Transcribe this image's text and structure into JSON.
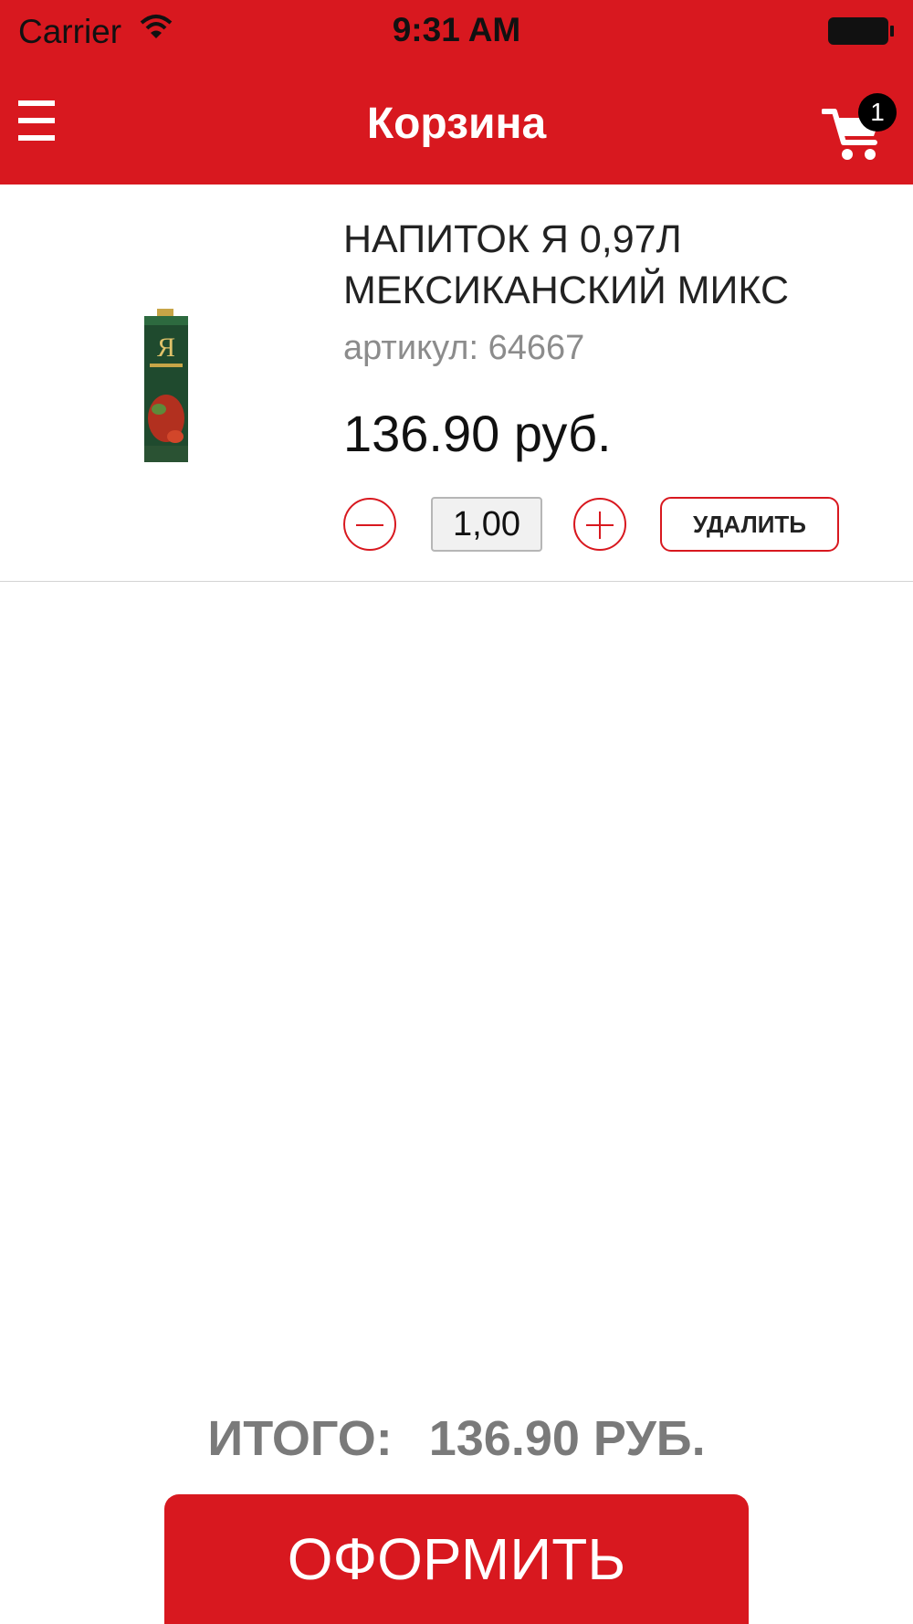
{
  "status_bar": {
    "carrier": "Carrier",
    "time": "9:31 AM"
  },
  "header": {
    "title": "Корзина",
    "cart_count": "1",
    "icons": {
      "menu": "hamburger-menu-icon",
      "cart": "shopping-cart-icon"
    }
  },
  "cart": {
    "items": [
      {
        "name": "НАПИТОК Я 0,97Л МЕКСИКАНСКИЙ МИКС",
        "sku_label": "артикул:",
        "sku": "64667",
        "price": "136.90 руб.",
        "quantity": "1,00",
        "delete_label": "УДАЛИТЬ"
      }
    ]
  },
  "footer": {
    "total_label": "ИТОГО:",
    "total_value": "136.90 РУБ.",
    "checkout_label": "ОФОРМИТЬ"
  },
  "colors": {
    "accent": "#d8181f",
    "muted_text": "#8c8c8c",
    "total_text": "#7a7a7a"
  }
}
